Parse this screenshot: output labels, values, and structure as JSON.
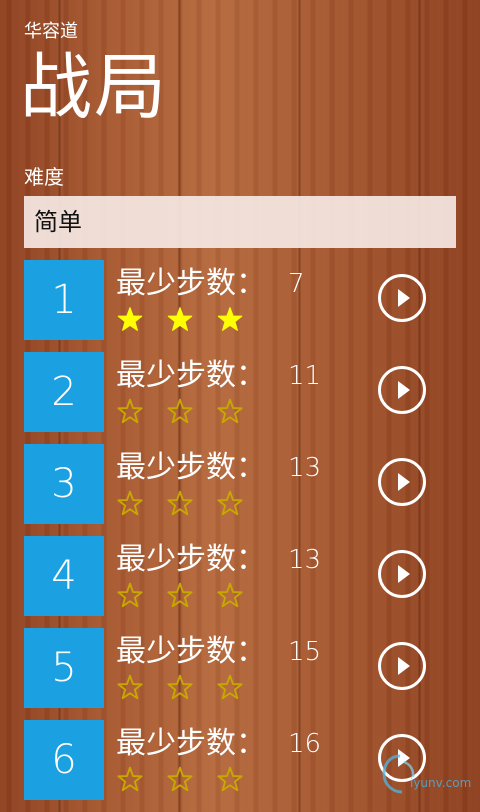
{
  "app": {
    "name": "华容道",
    "page_title": "战局"
  },
  "difficulty": {
    "label": "难度",
    "selected": "简单"
  },
  "steps_label": "最少步数：",
  "colors": {
    "tile": "#1ba1e2",
    "star_filled": "#ffff00",
    "star_outline": "#c8a800"
  },
  "levels": [
    {
      "number": "1",
      "min_steps": "7",
      "stars": 3
    },
    {
      "number": "2",
      "min_steps": "11",
      "stars": 0
    },
    {
      "number": "3",
      "min_steps": "13",
      "stars": 0
    },
    {
      "number": "4",
      "min_steps": "13",
      "stars": 0
    },
    {
      "number": "5",
      "min_steps": "15",
      "stars": 0
    },
    {
      "number": "6",
      "min_steps": "16",
      "stars": 0
    }
  ],
  "watermark": {
    "text": "iyunv.com"
  }
}
